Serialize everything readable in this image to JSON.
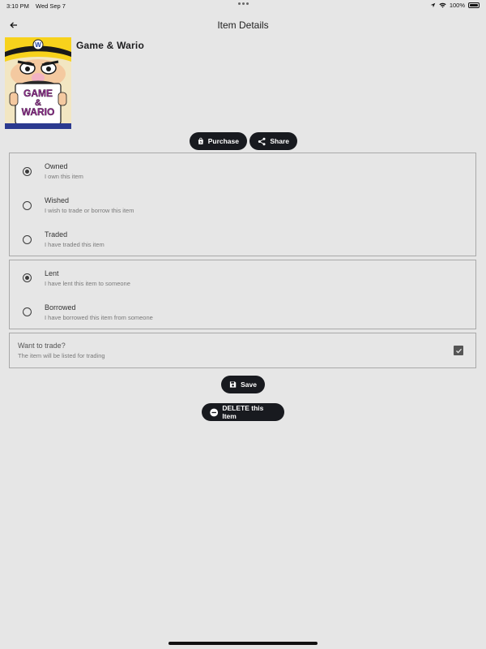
{
  "status_bar": {
    "time": "3:10 PM",
    "date": "Wed Sep 7",
    "battery": "100%"
  },
  "app_bar": {
    "title": "Item Details",
    "back_icon": "back-arrow-icon"
  },
  "item": {
    "name": "Game & Wario",
    "cover_text_top": "GAME",
    "cover_text_mid": "&",
    "cover_text_bottom": "WARIO"
  },
  "actions": {
    "purchase_label": "Purchase",
    "share_label": "Share"
  },
  "status_options": [
    {
      "title": "Owned",
      "subtitle": "I own this item",
      "selected": true
    },
    {
      "title": "Wished",
      "subtitle": "I wish to trade or borrow this item",
      "selected": false
    },
    {
      "title": "Traded",
      "subtitle": "I have traded this item",
      "selected": false
    }
  ],
  "loan_options": [
    {
      "title": "Lent",
      "subtitle": "I have lent this item to someone",
      "selected": true
    },
    {
      "title": "Borrowed",
      "subtitle": "I have borrowed this item from someone",
      "selected": false
    }
  ],
  "trade": {
    "title": "Want to trade?",
    "subtitle": "The item will be listed for trading",
    "checked": true
  },
  "buttons": {
    "save_label": "Save",
    "delete_label": "DELETE this Item"
  },
  "colors": {
    "background": "#e6e6e6",
    "button": "#181a1f",
    "border": "#a9a9a9"
  }
}
